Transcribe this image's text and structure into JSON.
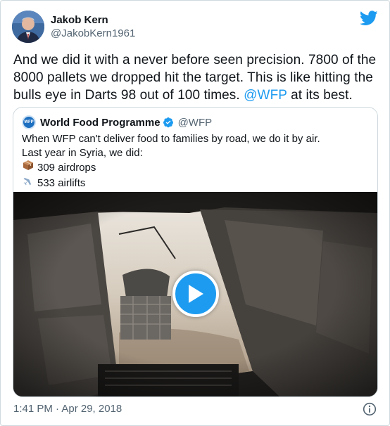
{
  "author": {
    "display_name": "Jakob Kern",
    "handle": "@JakobKern1961"
  },
  "tweet": {
    "text_before": "And we did it with a never before seen precision. 7800 of the 8000 pallets we dropped hit the target. This is like hitting the bulls eye in Darts 98 out of 100 times. ",
    "mention": "@WFP",
    "text_after": " at its best."
  },
  "quoted_tweet": {
    "avatar_text": "WFP",
    "display_name": "World Food Programme",
    "handle": "@WFP",
    "line1": "When WFP can't deliver food to families by road, we do it by air.",
    "line2": "Last year in Syria, we did:",
    "line3": "309 airdrops",
    "line4": "533 airlifts",
    "media": {
      "type": "video",
      "icon": "play-icon"
    }
  },
  "footer": {
    "timestamp": "1:41 PM · Apr 29, 2018"
  },
  "colors": {
    "accent": "#1d9bf0",
    "text": "#0f1419",
    "muted": "#536471",
    "border": "#cfd9de"
  }
}
